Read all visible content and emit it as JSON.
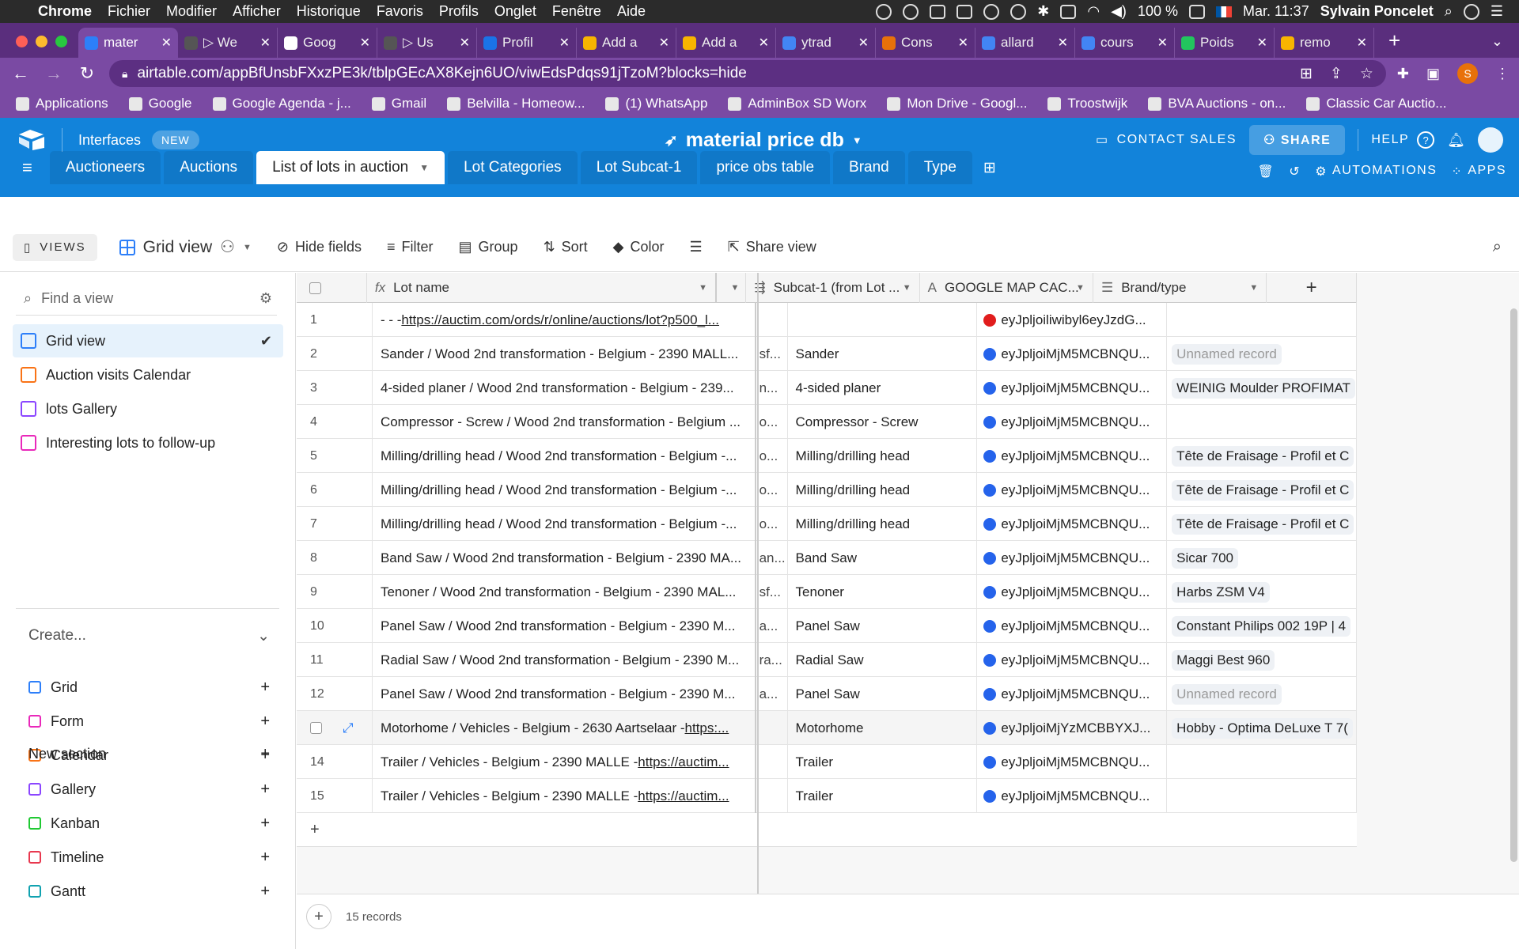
{
  "menubar": {
    "app": "Chrome",
    "items": [
      "Fichier",
      "Modifier",
      "Afficher",
      "Historique",
      "Favoris",
      "Profils",
      "Onglet",
      "Fenêtre",
      "Aide"
    ],
    "battery": "100 %",
    "datetime": "Mar. 11:37",
    "user": "Sylvain Poncelet"
  },
  "tabs": [
    {
      "label": "mater",
      "active": true,
      "color": "#2d7ff9"
    },
    {
      "label": "▷ We",
      "color": "#555"
    },
    {
      "label": "Goog",
      "color": "#fff"
    },
    {
      "label": "▷ Us",
      "color": "#555"
    },
    {
      "label": "Profil",
      "color": "#1a73e8"
    },
    {
      "label": "Add a",
      "color": "#f8b400"
    },
    {
      "label": "Add a",
      "color": "#f8b400"
    },
    {
      "label": "ytrad",
      "color": "#4285f4"
    },
    {
      "label": "Cons",
      "color": "#e8710a"
    },
    {
      "label": "allard",
      "color": "#4285f4"
    },
    {
      "label": "cours",
      "color": "#4285f4"
    },
    {
      "label": "Poids",
      "color": "#22c55e"
    },
    {
      "label": "remo",
      "color": "#f8b400"
    }
  ],
  "url": "airtable.com/appBfUnsbFXxzPE3k/tblpGEcAX8Kejn6UO/viwEdsPdqs91jTzoM?blocks=hide",
  "profile_initial": "S",
  "bookmarks": [
    "Applications",
    "Google",
    "Google Agenda - j...",
    "Gmail",
    "Belvilla - Homeow...",
    "(1) WhatsApp",
    "AdminBox SD Worx",
    "Mon Drive - Googl...",
    "Troostwijk",
    "BVA Auctions - on...",
    "Classic Car Auctio..."
  ],
  "airtable": {
    "interfaces": "Interfaces",
    "new_badge": "NEW",
    "base_name": "material price db",
    "contact_sales": "CONTACT SALES",
    "share": "SHARE",
    "help": "HELP",
    "tables": [
      "Auctioneers",
      "Auctions",
      "List of lots in auction",
      "Lot Categories",
      "Lot Subcat-1",
      "price obs table",
      "Brand",
      "Type"
    ],
    "active_table": "List of lots in auction",
    "automations": "AUTOMATIONS",
    "apps": "APPS"
  },
  "viewbar": {
    "views_label": "VIEWS",
    "view_name": "Grid view",
    "hide_fields": "Hide fields",
    "filter": "Filter",
    "group": "Group",
    "sort": "Sort",
    "color": "Color",
    "share_view": "Share view"
  },
  "sidebar": {
    "find_placeholder": "Find a view",
    "views": [
      {
        "label": "Grid view",
        "color": "#2d7ff9",
        "selected": true
      },
      {
        "label": "Auction visits Calendar",
        "color": "#f97316"
      },
      {
        "label": "lots Gallery",
        "color": "#8b46ff"
      },
      {
        "label": "Interesting lots to follow-up",
        "color": "#e929ba"
      }
    ],
    "create_label": "Create...",
    "create_items": [
      {
        "label": "Grid",
        "color": "#2d7ff9"
      },
      {
        "label": "Form",
        "color": "#e929ba"
      },
      {
        "label": "Calendar",
        "color": "#f97316"
      },
      {
        "label": "Gallery",
        "color": "#8b46ff"
      },
      {
        "label": "Kanban",
        "color": "#20c933"
      },
      {
        "label": "Timeline",
        "color": "#e8384f"
      },
      {
        "label": "Gantt",
        "color": "#11a2b0"
      }
    ],
    "new_section": "New section"
  },
  "grid": {
    "columns": {
      "lot_name": "Lot name",
      "subcat": "Subcat-1 (from Lot ...",
      "gmap": "GOOGLE MAP CAC...",
      "brand": "Brand/type"
    },
    "rows": [
      {
        "n": "1",
        "lot_pre": "- - - ",
        "lot_link": "https://auctim.com/ords/r/online/auctions/lot?p500_l...",
        "frag": "",
        "sub": "",
        "dot": "#e11d1d",
        "gmap": "eyJpljoiliwibyl6eyJzdG...",
        "brand": "",
        "brand_muted": false
      },
      {
        "n": "2",
        "lot_pre": "Sander / Wood 2nd transformation - Belgium - 2390 MALL...",
        "lot_link": "",
        "frag": "sf...",
        "sub": "Sander",
        "dot": "#2563eb",
        "gmap": "eyJpljoiMjM5MCBNQU...",
        "brand": "Unnamed record",
        "brand_muted": true
      },
      {
        "n": "3",
        "lot_pre": "4-sided planer / Wood 2nd transformation - Belgium - 239...",
        "lot_link": "",
        "frag": "n...",
        "sub": "4-sided planer",
        "dot": "#2563eb",
        "gmap": "eyJpljoiMjM5MCBNQU...",
        "brand": "WEINIG Moulder PROFIMAT",
        "brand_muted": false
      },
      {
        "n": "4",
        "lot_pre": "Compressor - Screw / Wood 2nd transformation - Belgium ...",
        "lot_link": "",
        "frag": "o...",
        "sub": "Compressor - Screw",
        "dot": "#2563eb",
        "gmap": "eyJpljoiMjM5MCBNQU...",
        "brand": "",
        "brand_muted": false
      },
      {
        "n": "5",
        "lot_pre": "Milling/drilling head / Wood 2nd transformation - Belgium -...",
        "lot_link": "",
        "frag": "o...",
        "sub": "Milling/drilling head",
        "dot": "#2563eb",
        "gmap": "eyJpljoiMjM5MCBNQU...",
        "brand": "Tête de Fraisage - Profil et C",
        "brand_muted": false
      },
      {
        "n": "6",
        "lot_pre": "Milling/drilling head / Wood 2nd transformation - Belgium -...",
        "lot_link": "",
        "frag": "o...",
        "sub": "Milling/drilling head",
        "dot": "#2563eb",
        "gmap": "eyJpljoiMjM5MCBNQU...",
        "brand": "Tête de Fraisage - Profil et C",
        "brand_muted": false
      },
      {
        "n": "7",
        "lot_pre": "Milling/drilling head / Wood 2nd transformation - Belgium -...",
        "lot_link": "",
        "frag": "o...",
        "sub": "Milling/drilling head",
        "dot": "#2563eb",
        "gmap": "eyJpljoiMjM5MCBNQU...",
        "brand": "Tête de Fraisage - Profil et C",
        "brand_muted": false
      },
      {
        "n": "8",
        "lot_pre": "Band Saw / Wood 2nd transformation - Belgium - 2390 MA...",
        "lot_link": "",
        "frag": "an...",
        "sub": "Band Saw",
        "dot": "#2563eb",
        "gmap": "eyJpljoiMjM5MCBNQU...",
        "brand": "Sicar 700",
        "brand_muted": false
      },
      {
        "n": "9",
        "lot_pre": "Tenoner / Wood 2nd transformation - Belgium - 2390 MAL...",
        "lot_link": "",
        "frag": "sf...",
        "sub": "Tenoner",
        "dot": "#2563eb",
        "gmap": "eyJpljoiMjM5MCBNQU...",
        "brand": "Harbs ZSM V4",
        "brand_muted": false
      },
      {
        "n": "10",
        "lot_pre": "Panel Saw / Wood 2nd transformation - Belgium - 2390 M...",
        "lot_link": "",
        "frag": "a...",
        "sub": "Panel Saw",
        "dot": "#2563eb",
        "gmap": "eyJpljoiMjM5MCBNQU...",
        "brand": "Constant Philips 002 19P | 4",
        "brand_muted": false
      },
      {
        "n": "11",
        "lot_pre": "Radial Saw / Wood 2nd transformation - Belgium - 2390 M...",
        "lot_link": "",
        "frag": "ra...",
        "sub": "Radial Saw",
        "dot": "#2563eb",
        "gmap": "eyJpljoiMjM5MCBNQU...",
        "brand": "Maggi Best 960",
        "brand_muted": false
      },
      {
        "n": "12",
        "lot_pre": "Panel Saw / Wood 2nd transformation - Belgium - 2390 M...",
        "lot_link": "",
        "frag": "a...",
        "sub": "Panel Saw",
        "dot": "#2563eb",
        "gmap": "eyJpljoiMjM5MCBNQU...",
        "brand": "Unnamed record",
        "brand_muted": true
      },
      {
        "n": "",
        "lot_pre": "Motorhome / Vehicles - Belgium - 2630 Aartselaar - ",
        "lot_link": "https:...",
        "frag": "",
        "sub": "Motorhome",
        "dot": "#2563eb",
        "gmap": "eyJpljoiMjYzMCBBYXJ...",
        "brand": "Hobby - Optima DeLuxe T 7(",
        "brand_muted": false,
        "hover": true
      },
      {
        "n": "14",
        "lot_pre": "Trailer / Vehicles - Belgium - 2390 MALLE - ",
        "lot_link": "https://auctim...",
        "frag": "",
        "sub": "Trailer",
        "dot": "#2563eb",
        "gmap": "eyJpljoiMjM5MCBNQU...",
        "brand": "",
        "brand_muted": false
      },
      {
        "n": "15",
        "lot_pre": "Trailer / Vehicles - Belgium - 2390 MALLE - ",
        "lot_link": "https://auctim...",
        "frag": "",
        "sub": "Trailer",
        "dot": "#2563eb",
        "gmap": "eyJpljoiMjM5MCBNQU...",
        "brand": "",
        "brand_muted": false
      }
    ],
    "record_count": "15 records"
  }
}
